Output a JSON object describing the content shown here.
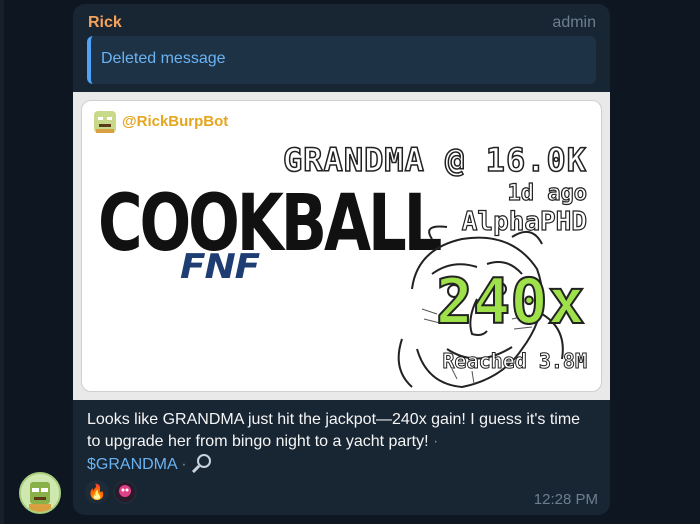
{
  "message": {
    "sender": "Rick",
    "role": "admin",
    "reply_text": "Deleted message",
    "time": "12:28 PM"
  },
  "card": {
    "bot_handle": "@RickBurpBot",
    "ticker_line": "GRANDMA @ 16.0K",
    "age": "1d ago",
    "user": "AlphaPHD",
    "multiplier": "240x",
    "reached": "Reached 3.8M",
    "logo_main": "COOKBALL",
    "logo_sub": "FNF"
  },
  "caption": {
    "text": "Looks like GRANDMA just hit the jackpot—240x gain! I guess it's time to upgrade her from bingo night to a yacht party!",
    "sep1": " · ",
    "cashtag": "$GRANDMA",
    "sep2": " · "
  },
  "reactions": [
    {
      "icon": "fire-icon",
      "glyph": "🔥"
    },
    {
      "icon": "pink-avatar-icon",
      "glyph": ""
    }
  ],
  "colors": {
    "sender": "#f5a35c",
    "link": "#6ab3f3",
    "multiplier": "#9ee14a",
    "bubble": "#182533",
    "background": "#0e1621"
  }
}
